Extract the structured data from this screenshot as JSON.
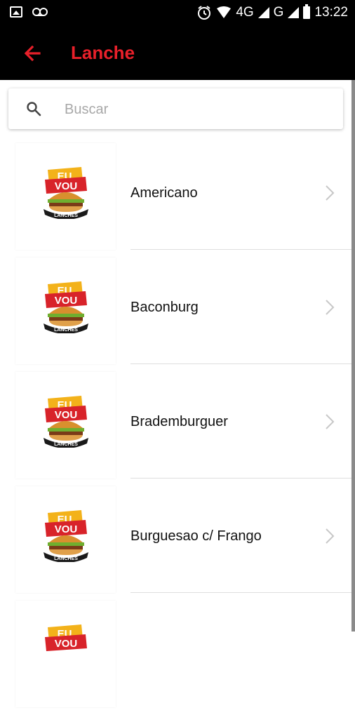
{
  "status_bar": {
    "network_label": "4G",
    "network_label_2": "G",
    "time": "13:22",
    "icons": [
      "image-icon",
      "voicemail-icon",
      "alarm-icon",
      "wifi-icon",
      "signal-icon",
      "battery-icon"
    ]
  },
  "app_bar": {
    "title": "Lanche",
    "back_icon": "arrow-left-icon",
    "accent_color": "#e8202a"
  },
  "search": {
    "placeholder": "Buscar",
    "value": ""
  },
  "items": [
    {
      "label": "Americano"
    },
    {
      "label": "Baconburg"
    },
    {
      "label": "Brademburguer"
    },
    {
      "label": "Burguesao c/ Frango"
    },
    {
      "label": ""
    }
  ],
  "logo_text": {
    "line1": "EU",
    "line2": "VOU",
    "line3": "LANCHES"
  }
}
